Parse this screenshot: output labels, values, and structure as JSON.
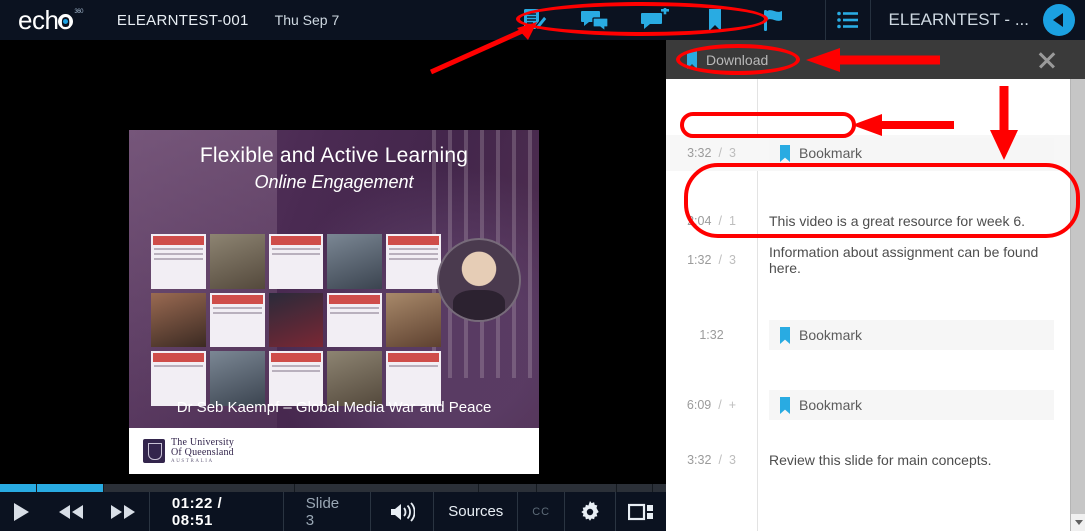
{
  "header": {
    "brand": "echo",
    "brand_superscript": "360",
    "course_code": "ELEARNTEST-001",
    "date": "Thu Sep 7",
    "lecture_title": "ELEARNTEST - ...",
    "icons": [
      {
        "name": "notes-icon",
        "label": "Notes"
      },
      {
        "name": "discussion-icon",
        "label": "Discussion"
      },
      {
        "name": "add-comment-icon",
        "label": "Add comment"
      },
      {
        "name": "bookmark-icon",
        "label": "Bookmark"
      },
      {
        "name": "flag-confusion-icon",
        "label": "Flag confusion"
      }
    ],
    "list_icon": "list-view-icon",
    "collapse_icon": "collapse-panel-icon",
    "accent_color": "#1ba1e2",
    "background_color": "#0b1220"
  },
  "slide": {
    "title": "Flexible and Active Learning",
    "subtitle": "Online Engagement",
    "presenter": "Dr Seb Kaempf – Global Media War and Peace",
    "institution_line1": "The University",
    "institution_line2": "Of Queensland",
    "institution_line3": "AUSTRALIA",
    "accent_color": "#4a2c52"
  },
  "player": {
    "play_label": "play-button",
    "rewind_label": "rewind-button",
    "forward_label": "fast-forward-button",
    "time": "01:22 / 08:51",
    "elapsed": "01:22",
    "duration": "08:51",
    "slide_label": "Slide 3",
    "volume_label": "volume-button",
    "sources_label": "Sources",
    "cc_label": "CC",
    "settings_label": "settings-button",
    "layout_label": "layout-button",
    "progress_percent": 15.5,
    "progress_color": "#29abe2"
  },
  "panel": {
    "download_label": "Download",
    "close_label": "close-panel",
    "bookmark_color": "#29abe2",
    "rows": [
      {
        "time": "3:32",
        "slide": "3",
        "type": "bookmark",
        "label": "Bookmark",
        "highlight": true
      },
      {
        "time": "2:04",
        "slide": "1",
        "type": "note",
        "label": "This video is a great resource for week 6."
      },
      {
        "time": "1:32",
        "slide": "3",
        "type": "note",
        "label": "Information about assignment can be found here."
      },
      {
        "time": "1:32",
        "slide": "",
        "type": "bookmark",
        "label": "Bookmark"
      },
      {
        "time": "6:09",
        "slide": "+",
        "type": "bookmark",
        "label": "Bookmark"
      },
      {
        "time": "3:32",
        "slide": "3",
        "type": "note",
        "label": "Review this slide for main concepts."
      }
    ]
  },
  "annotations": {
    "color": "#ff0000",
    "items": [
      {
        "name": "annotation-ellipse-toolbar",
        "shape": "ellipse"
      },
      {
        "name": "annotation-arrow-to-toolbar",
        "shape": "arrow-diagonal"
      },
      {
        "name": "annotation-ellipse-download",
        "shape": "ellipse"
      },
      {
        "name": "annotation-arrow-to-download",
        "shape": "arrow-left"
      },
      {
        "name": "annotation-ellipse-bookmark-row",
        "shape": "rounded-rect"
      },
      {
        "name": "annotation-arrow-to-bookmark-row",
        "shape": "arrow-left"
      },
      {
        "name": "annotation-arrow-down-to-notes",
        "shape": "arrow-down"
      },
      {
        "name": "annotation-rounded-rect-notes",
        "shape": "rounded-rect"
      }
    ]
  }
}
